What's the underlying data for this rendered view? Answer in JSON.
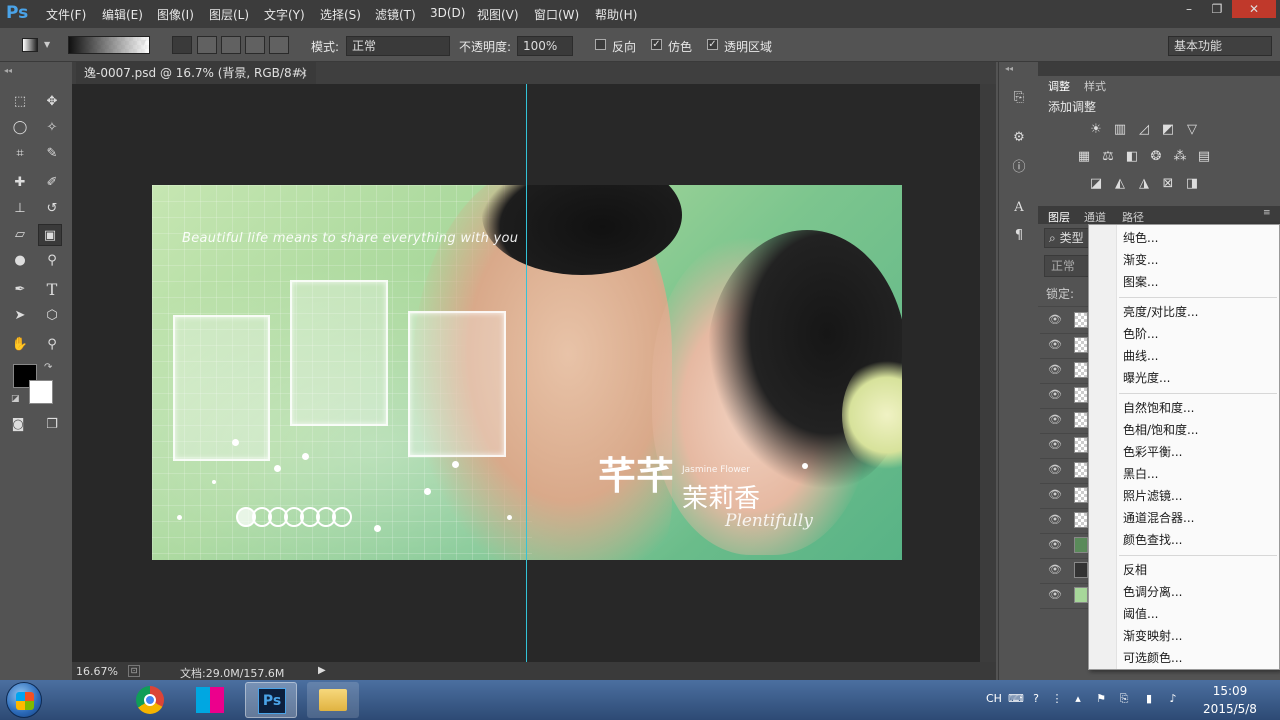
{
  "app": {
    "logo": "Ps"
  },
  "menubar": {
    "items": [
      "文件(F)",
      "编辑(E)",
      "图像(I)",
      "图层(L)",
      "文字(Y)",
      "选择(S)",
      "滤镜(T)",
      "3D(D)",
      "视图(V)",
      "窗口(W)",
      "帮助(H)"
    ],
    "window_controls": {
      "minimize": "–",
      "restore": "❐",
      "close": "✕"
    }
  },
  "options": {
    "mode_label": "模式:",
    "mode_value": "正常",
    "opacity_label": "不透明度:",
    "opacity_value": "100%",
    "reverse_label": "反向",
    "dither_label": "仿色",
    "transparency_label": "透明区域",
    "workspace_value": "基本功能",
    "dither_checked": true,
    "transparency_checked": true,
    "reverse_checked": false
  },
  "document": {
    "tab_title": "逸-0007.psd @ 16.7% (背景, RGB/8#) *",
    "tab_close": "×",
    "photo_tagline": "Beautiful life means to share everything with you",
    "photo_title_cn": "茉莉香",
    "photo_title_script": "Plentifully",
    "photo_title_small": "Jasmine Flower",
    "photo_title_big": "芊芊"
  },
  "status": {
    "zoom": "16.67%",
    "doc_info": "文档:29.0M/157.6M",
    "arrow": "▶"
  },
  "panels": {
    "adjust_tab": "调整",
    "style_tab": "样式",
    "add_adjustment": "添加调整",
    "layers_tab": "图层",
    "channels_tab": "通道",
    "paths_tab": "路径",
    "filter_type": "类型",
    "blend_mode": "正常",
    "lock_label": "锁定:"
  },
  "context_menu": {
    "group1": [
      "纯色...",
      "渐变...",
      "图案..."
    ],
    "group2": [
      "亮度/对比度...",
      "色阶...",
      "曲线...",
      "曝光度..."
    ],
    "group3": [
      "自然饱和度...",
      "色相/饱和度...",
      "色彩平衡...",
      "黑白...",
      "照片滤镜...",
      "通道混合器...",
      "颜色查找..."
    ],
    "group4": [
      "反相",
      "色调分离...",
      "阈值...",
      "渐变映射...",
      "可选颜色..."
    ]
  },
  "taskbar": {
    "tray_lang": "CH",
    "time": "15:09",
    "date": "2015/5/8",
    "ps_label": "Ps"
  },
  "colors": {
    "accent_ps": "#4aa3e8",
    "taskbar": "#2d4a74",
    "canvas_bg": "#282828"
  },
  "icons": [
    "marquee-icon",
    "move-icon",
    "lasso-icon",
    "magic-wand-icon",
    "crop-icon",
    "eyedropper-icon",
    "healing-icon",
    "brush-icon",
    "stamp-icon",
    "history-brush-icon",
    "eraser-icon",
    "gradient-icon",
    "blur-icon",
    "dodge-icon",
    "pen-icon",
    "type-icon",
    "path-select-icon",
    "shape-icon",
    "hand-icon",
    "zoom-icon"
  ]
}
